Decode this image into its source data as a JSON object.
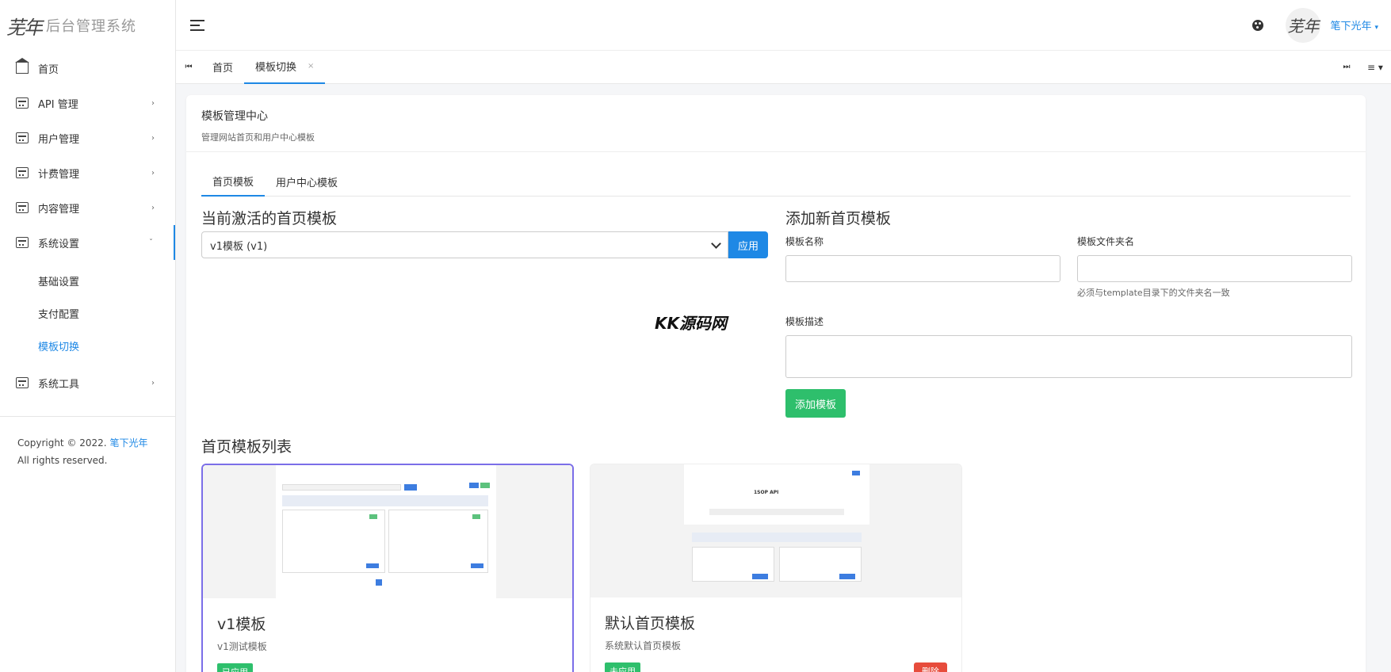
{
  "app": {
    "logo_mark": "芜年",
    "title": "后台管理系统"
  },
  "sidebar": {
    "items": [
      {
        "label": "首页",
        "icon": "home-icon"
      },
      {
        "label": "API 管理",
        "icon": "calendar-icon",
        "chevron": "›"
      },
      {
        "label": "用户管理",
        "icon": "calendar-icon",
        "chevron": "›"
      },
      {
        "label": "计费管理",
        "icon": "calendar-icon",
        "chevron": "›"
      },
      {
        "label": "内容管理",
        "icon": "calendar-icon",
        "chevron": "›"
      },
      {
        "label": "系统设置",
        "icon": "calendar-icon",
        "chevron": "ˇ"
      },
      {
        "label": "系统工具",
        "icon": "calendar-icon",
        "chevron": "›"
      }
    ],
    "subitems": [
      "基础设置",
      "支付配置",
      "模板切换"
    ],
    "copyright_prefix": "Copyright © 2022.",
    "copyright_link": "笔下光年",
    "copyright_suffix": "All rights reserved."
  },
  "header": {
    "avatar_text": "芜年",
    "username": "笔下光年",
    "caret": "▾"
  },
  "tabs": {
    "first_btn": "⏮",
    "last_btn": "⏭",
    "menu_btn": "≡ ▾",
    "items": [
      {
        "label": "首页"
      },
      {
        "label": "模板切换",
        "close": "×"
      }
    ]
  },
  "card": {
    "title": "模板管理中心",
    "subtitle": "管理网站首页和用户中心模板",
    "subtabs": [
      "首页模板",
      "用户中心模板"
    ],
    "current_section": "当前激活的首页模板",
    "select_value": "v1模板 (v1)",
    "apply_label": "应用",
    "add_section": "添加新首页模板",
    "name_label": "模板名称",
    "folder_label": "模板文件夹名",
    "folder_help": "必须与template目录下的文件夹名一致",
    "desc_label": "模板描述",
    "add_label": "添加模板",
    "list_section": "首页模板列表",
    "templates": [
      {
        "name": "v1模板",
        "desc": "v1测试模板",
        "badge": "已应用"
      },
      {
        "name": "默认首页模板",
        "desc": "系统默认首页模板",
        "badge": "未应用",
        "delete": "删除"
      }
    ]
  },
  "preview2": {
    "heading": "1SOP API"
  },
  "watermark": "KK源码网",
  "colors": {
    "accent": "#1e88e5",
    "success": "#2ebf6c",
    "danger": "#e74c3c",
    "selected_border": "#7b6ee8"
  }
}
